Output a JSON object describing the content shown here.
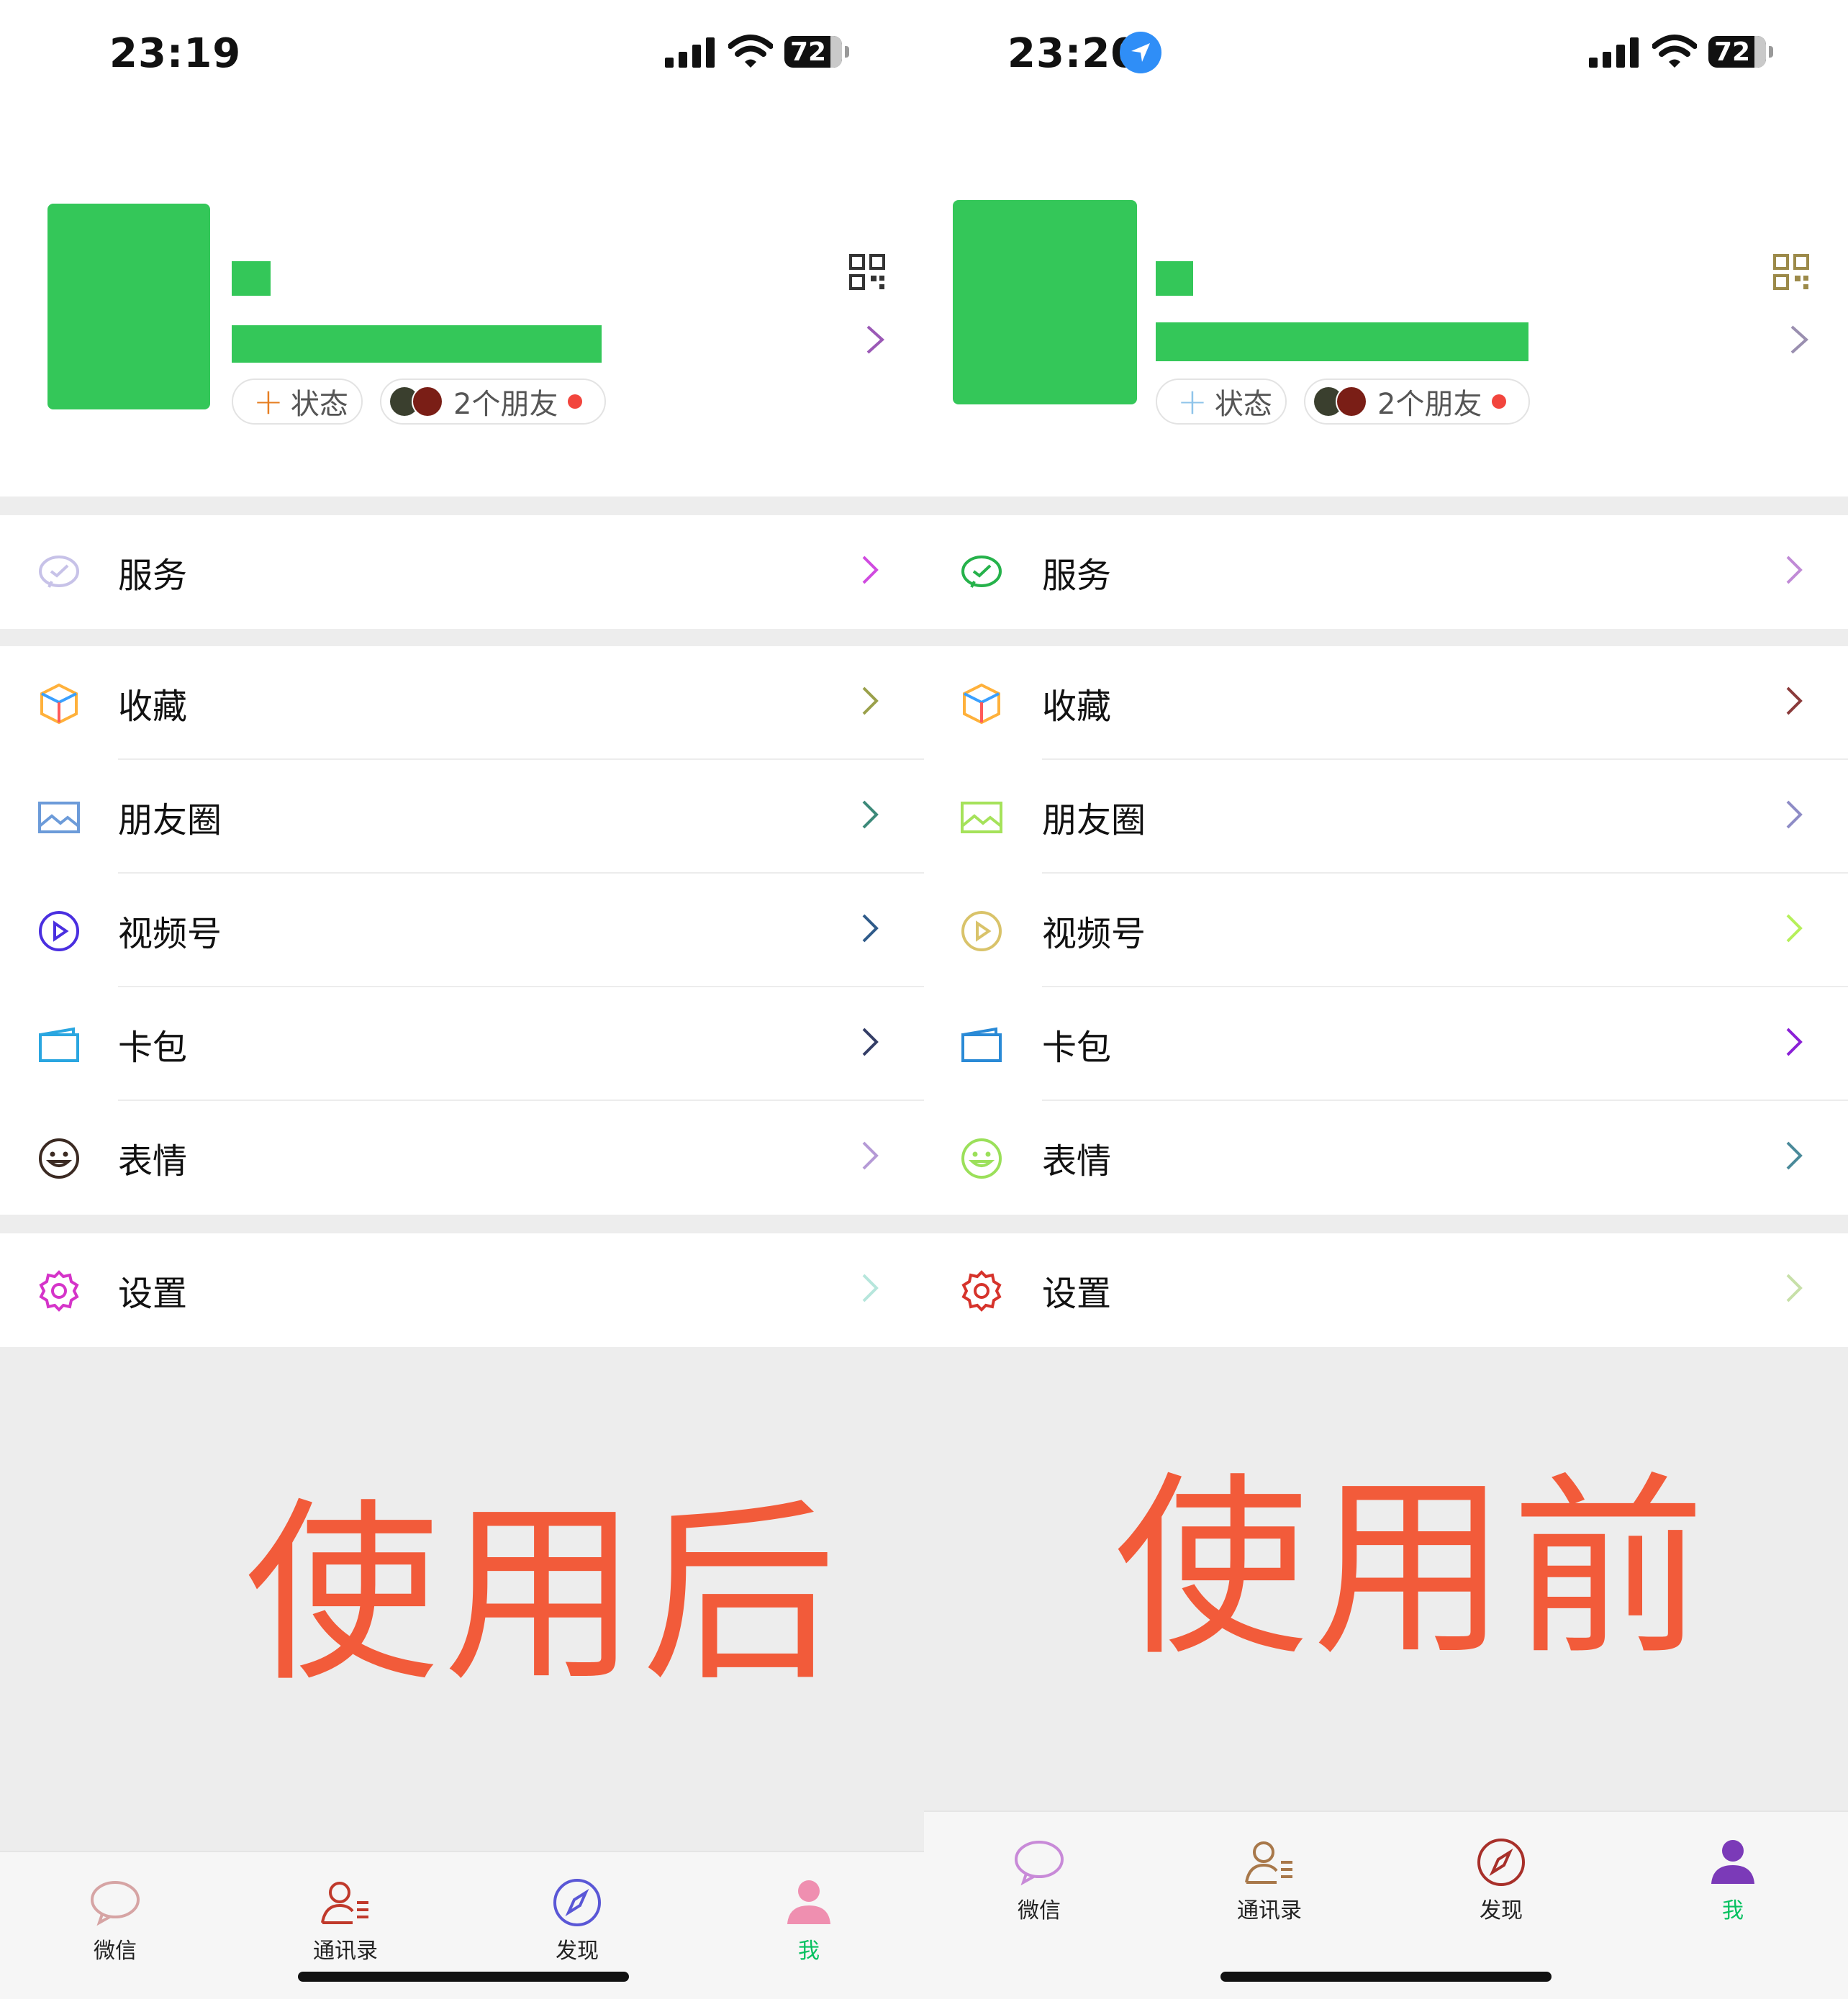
{
  "panels": {
    "left": {
      "time": "23:19",
      "battery": "72",
      "status_pill": "状态",
      "friends_pill": "2个朋友",
      "menu": {
        "services": "服务",
        "favorites": "收藏",
        "moments": "朋友圈",
        "channels": "视频号",
        "cards": "卡包",
        "stickers": "表情",
        "settings": "设置"
      },
      "caption": "使用后",
      "tabs": [
        "微信",
        "通讯录",
        "发现",
        "我"
      ]
    },
    "right": {
      "time": "23:20",
      "battery": "72",
      "status_pill": "状态",
      "friends_pill": "2个朋友",
      "menu": {
        "services": "服务",
        "favorites": "收藏",
        "moments": "朋友圈",
        "channels": "视频号",
        "cards": "卡包",
        "stickers": "表情",
        "settings": "设置"
      },
      "caption": "使用前",
      "tabs": [
        "微信",
        "通讯录",
        "发现",
        "我"
      ]
    }
  },
  "colors": {
    "redaction_green": "#34c759",
    "caption_red": "#f25b3a",
    "active_tab": "#07c160"
  },
  "icons": [
    "location-arrow-icon",
    "signal-icon",
    "wifi-icon",
    "battery-icon",
    "qr-code-icon",
    "chevron-right-icon",
    "services-icon",
    "favorites-cube-icon",
    "moments-image-icon",
    "channels-play-icon",
    "cards-wallet-icon",
    "stickers-smile-icon",
    "settings-gear-icon",
    "chats-bubble-icon",
    "contacts-icon",
    "discover-compass-icon",
    "me-person-icon"
  ]
}
